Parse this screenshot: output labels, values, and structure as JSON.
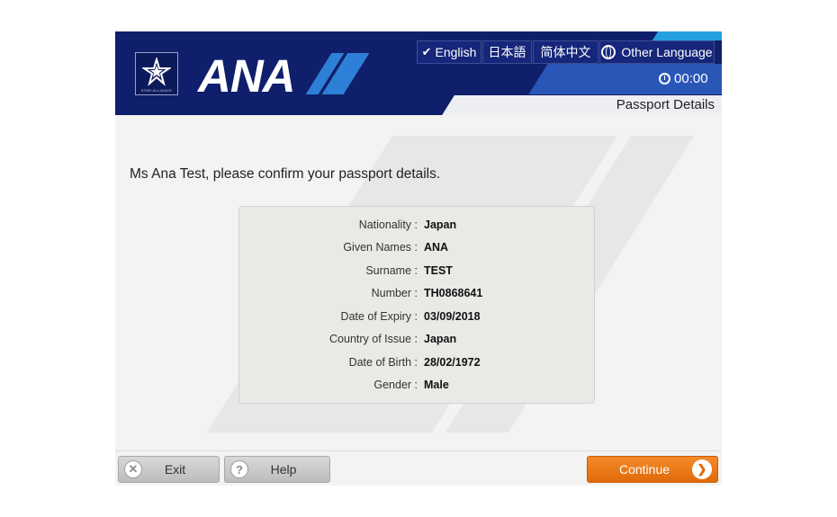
{
  "header": {
    "logo_text": "ANA",
    "star_alliance_text": "STAR ALLIANCE",
    "languages": [
      {
        "label": "English",
        "selected": true
      },
      {
        "label": "日本語",
        "selected": false
      },
      {
        "label": "简体中文",
        "selected": false
      },
      {
        "label": "Other Language",
        "selected": false
      }
    ],
    "timer": "00:00",
    "page_title": "Passport Details"
  },
  "main": {
    "prompt": "Ms Ana Test, please confirm your passport details.",
    "passport": [
      {
        "label": "Nationality :",
        "value": "Japan"
      },
      {
        "label": "Given Names :",
        "value": "ANA"
      },
      {
        "label": "Surname :",
        "value": "TEST"
      },
      {
        "label": "Number :",
        "value": "TH0868641"
      },
      {
        "label": "Date of Expiry :",
        "value": "03/09/2018"
      },
      {
        "label": "Country of Issue :",
        "value": "Japan"
      },
      {
        "label": "Date of Birth :",
        "value": "28/02/1972"
      },
      {
        "label": "Gender :",
        "value": "Male"
      }
    ]
  },
  "footer": {
    "exit_label": "Exit",
    "help_label": "Help",
    "help_icon_glyph": "?",
    "continue_label": "Continue"
  },
  "colors": {
    "header_navy": "#101f6b",
    "accent_blue": "#2e7fd8",
    "continue_orange": "#f07a1a"
  }
}
